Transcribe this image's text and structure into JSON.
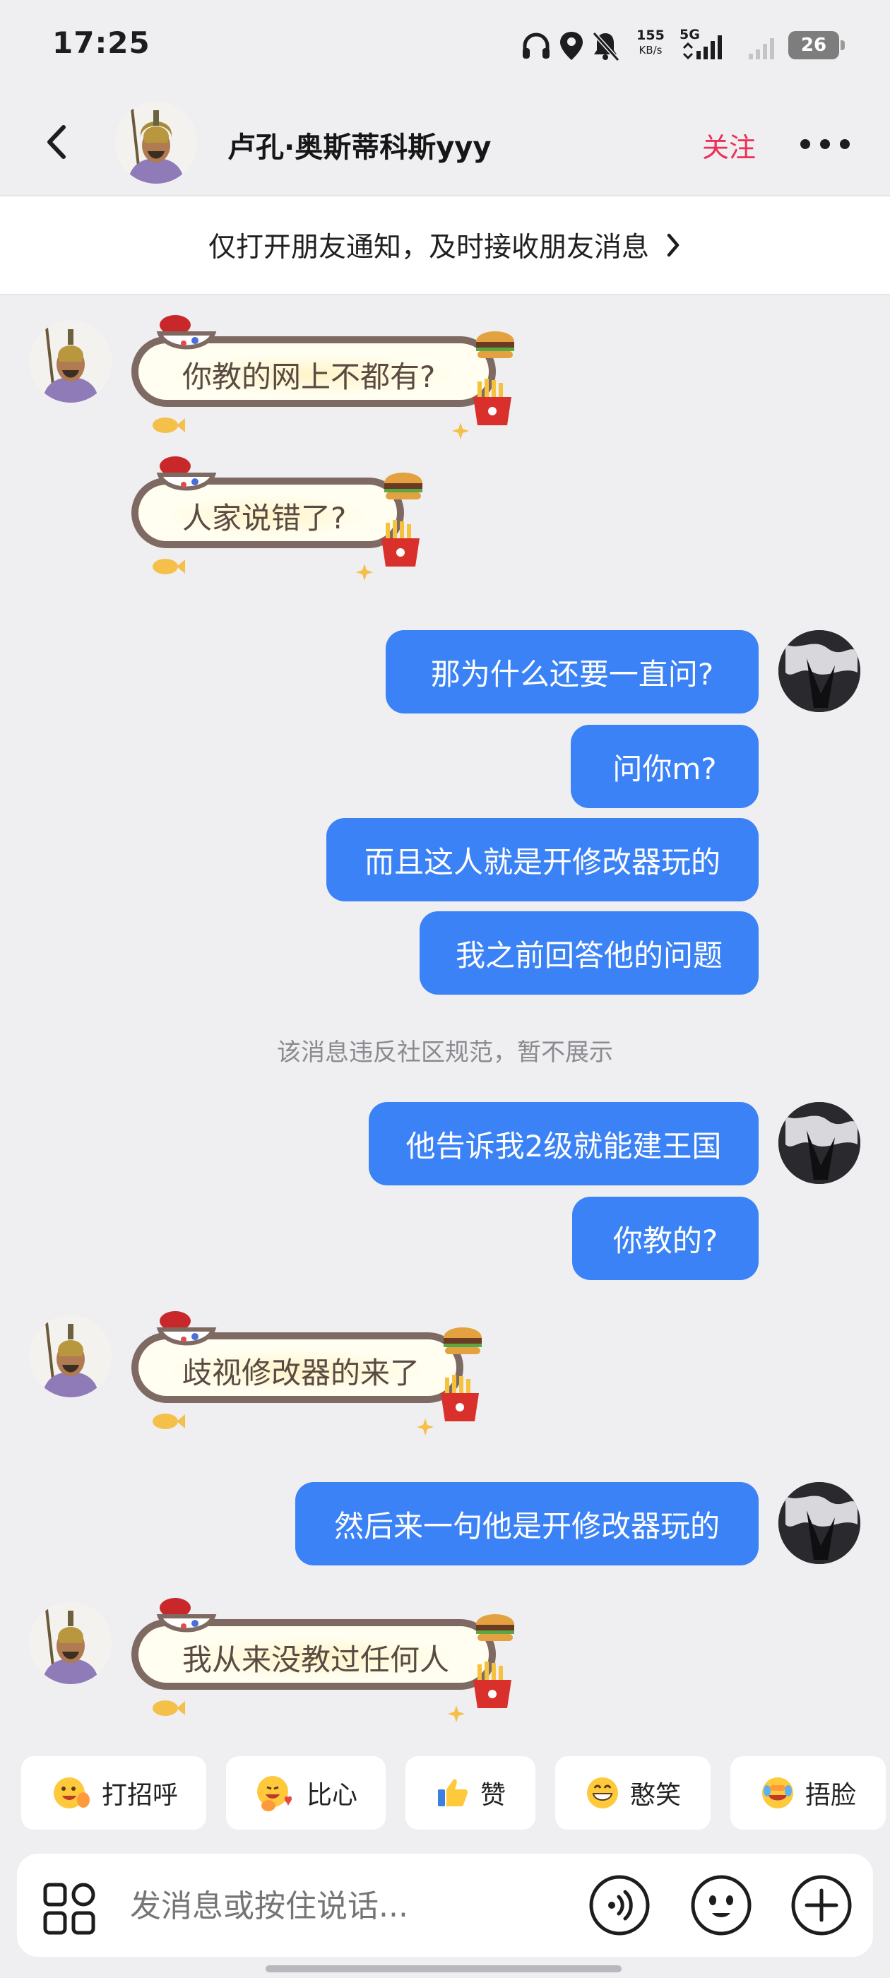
{
  "status_bar": {
    "time": "17:25",
    "net_speed_value": "155",
    "net_speed_unit": "KB/s",
    "network_type": "5G",
    "battery": "26"
  },
  "header": {
    "contact_name": "卢孔·奥斯蒂科斯yyy",
    "follow_label": "关注"
  },
  "notify_banner": {
    "text": "仅打开朋友通知，及时接收朋友消息"
  },
  "messages": [
    {
      "side": "in",
      "text": "你教的网上不都有?"
    },
    {
      "side": "in",
      "text": "人家说错了?"
    },
    {
      "side": "out",
      "text": "那为什么还要一直问?"
    },
    {
      "side": "out",
      "text": "问你m?"
    },
    {
      "side": "out",
      "text": "而且这人就是开修改器玩的"
    },
    {
      "side": "out",
      "text": "我之前回答他的问题"
    },
    {
      "side": "system",
      "text": "该消息违反社区规范，暂不展示"
    },
    {
      "side": "out",
      "text": "他告诉我2级就能建王国"
    },
    {
      "side": "out",
      "text": "你教的?"
    },
    {
      "side": "in",
      "text": "歧视修改器的来了"
    },
    {
      "side": "out",
      "text": "然后来一句他是开修改器玩的"
    },
    {
      "side": "in",
      "text": "我从来没教过任何人"
    }
  ],
  "quick_replies": [
    {
      "label": "打招呼",
      "icon": "waving-face-icon"
    },
    {
      "label": "比心",
      "icon": "heart-hands-face-icon"
    },
    {
      "label": "赞",
      "icon": "thumbs-up-icon"
    },
    {
      "label": "憨笑",
      "icon": "grinning-face-icon"
    },
    {
      "label": "捂脸",
      "icon": "facepalm-laugh-icon"
    }
  ],
  "composer": {
    "placeholder": "发消息或按住说话..."
  },
  "colors": {
    "outgoing_bubble": "#3b82f6",
    "follow_accent": "#ee2e55",
    "background": "#efeff2"
  }
}
